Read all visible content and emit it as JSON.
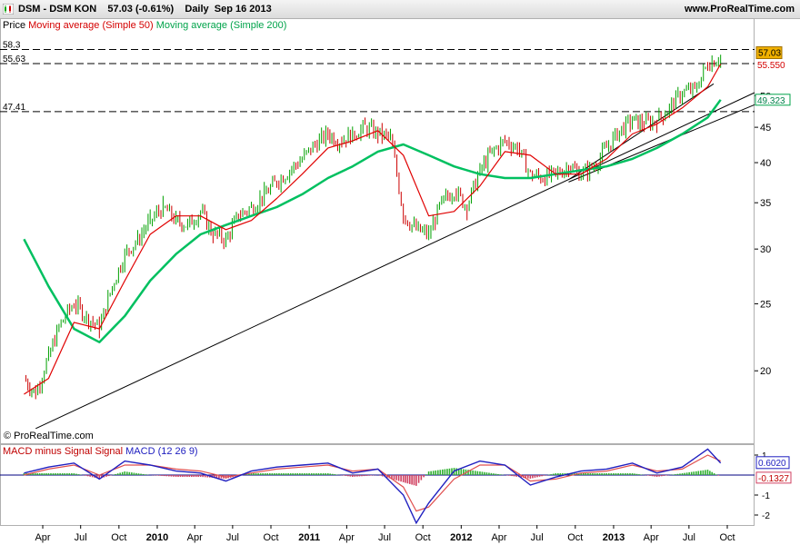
{
  "header": {
    "left_text": "DSM - DSM KON    57.03 (-0.61%)    Daily  Sep 16 2013",
    "right_text": "www.ProRealTime.com"
  },
  "indicators": {
    "price_label": "Price",
    "ma50_label": "Moving average (Simple 50)",
    "ma200_label": "Moving average (Simple 200)"
  },
  "watermark": "© ProRealTime.com",
  "macd_legend": {
    "part1": "MACD minus Signal",
    "part2": "Signal",
    "part3": "MACD (12 26 9)"
  },
  "colors": {
    "price_up": "#00a000",
    "price_down": "#cc0000",
    "ma50": "#e00000",
    "ma200": "#00c060",
    "macd": "#2020c0",
    "signal": "#e05050",
    "last_price_bg": "#f0b000",
    "ma200_badge_border": "#00a34a"
  },
  "chart_data": [
    {
      "type": "line",
      "title": "DSM - DSM KON Daily",
      "y_scale": "log",
      "ylim": [
        16,
        60
      ],
      "y_ticks": [
        20,
        25,
        30,
        35,
        40,
        45,
        50
      ],
      "x_range": [
        "2009-02",
        "2013-10"
      ],
      "x_tick_labels": [
        "Apr",
        "Jul",
        "Oct",
        "2010",
        "Apr",
        "Jul",
        "Oct",
        "2011",
        "Apr",
        "Jul",
        "Oct",
        "2012",
        "Apr",
        "Jul",
        "Oct",
        "2013",
        "Apr",
        "Jul",
        "Oct"
      ],
      "horizontal_levels": [
        {
          "label": "58.3",
          "value": 58.3
        },
        {
          "label": "55.63",
          "value": 55.63
        },
        {
          "label": "47.41",
          "value": 47.41
        }
      ],
      "last_price": "57.03",
      "ma50_value": "55.550",
      "ma200_value": "49.323",
      "series": [
        {
          "name": "Price",
          "x": [
            "2009-02",
            "2009-03",
            "2009-04",
            "2009-05",
            "2009-06",
            "2009-07",
            "2009-08",
            "2009-09",
            "2009-10",
            "2009-11",
            "2009-12",
            "2010-01",
            "2010-02",
            "2010-03",
            "2010-04",
            "2010-05",
            "2010-06",
            "2010-07",
            "2010-08",
            "2010-09",
            "2010-10",
            "2010-11",
            "2010-12",
            "2011-01",
            "2011-02",
            "2011-03",
            "2011-04",
            "2011-05",
            "2011-06",
            "2011-07",
            "2011-08",
            "2011-09",
            "2011-10",
            "2011-11",
            "2011-12",
            "2012-01",
            "2012-02",
            "2012-03",
            "2012-04",
            "2012-05",
            "2012-06",
            "2012-07",
            "2012-08",
            "2012-09",
            "2012-10",
            "2012-11",
            "2012-12",
            "2013-01",
            "2013-02",
            "2013-03",
            "2013-04",
            "2013-05",
            "2013-06",
            "2013-07",
            "2013-08",
            "2013-09"
          ],
          "values": [
            19.5,
            18.5,
            21.0,
            23.5,
            25.0,
            24.0,
            23.0,
            26.5,
            29.5,
            31.0,
            33.0,
            34.5,
            33.0,
            32.5,
            34.0,
            31.5,
            31.0,
            33.5,
            34.5,
            36.0,
            37.5,
            39.0,
            40.5,
            42.5,
            44.0,
            43.0,
            44.0,
            45.0,
            44.0,
            43.5,
            33.5,
            32.0,
            31.5,
            35.0,
            36.5,
            34.5,
            39.0,
            41.5,
            43.0,
            42.0,
            38.5,
            38.0,
            38.5,
            39.5,
            38.5,
            39.5,
            42.0,
            44.5,
            46.0,
            45.5,
            46.0,
            48.0,
            50.5,
            51.0,
            55.5,
            57.03
          ]
        },
        {
          "name": "Moving average (Simple 50)",
          "x": [
            "2009-02",
            "2009-04",
            "2009-06",
            "2009-08",
            "2009-10",
            "2009-12",
            "2010-02",
            "2010-04",
            "2010-06",
            "2010-08",
            "2010-10",
            "2010-12",
            "2011-02",
            "2011-04",
            "2011-06",
            "2011-08",
            "2011-10",
            "2011-12",
            "2012-02",
            "2012-04",
            "2012-06",
            "2012-08",
            "2012-10",
            "2012-12",
            "2013-02",
            "2013-04",
            "2013-06",
            "2013-08",
            "2013-09"
          ],
          "values": [
            18.5,
            19.5,
            23.5,
            23.0,
            27.0,
            31.5,
            33.5,
            33.5,
            32.0,
            33.0,
            35.5,
            38.5,
            42.0,
            43.0,
            44.5,
            41.0,
            33.5,
            34.0,
            37.0,
            41.5,
            41.0,
            38.5,
            38.5,
            40.5,
            44.0,
            45.5,
            48.0,
            51.5,
            55.55
          ]
        },
        {
          "name": "Moving average (Simple 200)",
          "x": [
            "2009-02",
            "2009-04",
            "2009-06",
            "2009-08",
            "2009-10",
            "2009-12",
            "2010-02",
            "2010-04",
            "2010-06",
            "2010-08",
            "2010-10",
            "2010-12",
            "2011-02",
            "2011-04",
            "2011-06",
            "2011-08",
            "2011-10",
            "2011-12",
            "2012-02",
            "2012-04",
            "2012-06",
            "2012-08",
            "2012-10",
            "2012-12",
            "2013-02",
            "2013-04",
            "2013-06",
            "2013-08",
            "2013-09"
          ],
          "values": [
            31.0,
            26.5,
            23.0,
            22.0,
            24.0,
            27.0,
            29.5,
            31.5,
            32.5,
            33.5,
            34.5,
            36.0,
            38.0,
            39.5,
            41.5,
            42.5,
            41.0,
            39.5,
            38.5,
            38.0,
            38.0,
            38.5,
            39.0,
            39.5,
            40.5,
            42.0,
            44.0,
            46.5,
            49.32
          ]
        }
      ]
    },
    {
      "type": "line",
      "title": "MACD (12 26 9)",
      "ylim": [
        -2.5,
        1.5
      ],
      "y_ticks": [
        1,
        -1,
        -2
      ],
      "macd_value": "0.6020",
      "signal_value": "-0.1327",
      "series": [
        {
          "name": "MACD",
          "x": [
            "2009-02",
            "2009-04",
            "2009-06",
            "2009-08",
            "2009-10",
            "2009-12",
            "2010-02",
            "2010-04",
            "2010-06",
            "2010-08",
            "2010-10",
            "2010-12",
            "2011-02",
            "2011-04",
            "2011-06",
            "2011-08",
            "2011-09",
            "2011-10",
            "2011-12",
            "2012-02",
            "2012-04",
            "2012-06",
            "2012-08",
            "2012-10",
            "2012-12",
            "2013-02",
            "2013-04",
            "2013-06",
            "2013-08",
            "2013-09"
          ],
          "values": [
            0.1,
            0.4,
            0.6,
            -0.2,
            0.7,
            0.5,
            0.2,
            0.1,
            -0.3,
            0.2,
            0.4,
            0.5,
            0.6,
            0.1,
            0.3,
            -1.0,
            -2.4,
            -1.4,
            0.2,
            0.7,
            0.5,
            -0.5,
            -0.1,
            0.2,
            0.3,
            0.6,
            0.1,
            0.4,
            1.3,
            0.6
          ]
        },
        {
          "name": "Signal",
          "x": [
            "2009-02",
            "2009-04",
            "2009-06",
            "2009-08",
            "2009-10",
            "2009-12",
            "2010-02",
            "2010-04",
            "2010-06",
            "2010-08",
            "2010-10",
            "2010-12",
            "2011-02",
            "2011-04",
            "2011-06",
            "2011-08",
            "2011-09",
            "2011-10",
            "2011-12",
            "2012-02",
            "2012-04",
            "2012-06",
            "2012-08",
            "2012-10",
            "2012-12",
            "2013-02",
            "2013-04",
            "2013-06",
            "2013-08",
            "2013-09"
          ],
          "values": [
            0.0,
            0.3,
            0.5,
            0.0,
            0.5,
            0.5,
            0.3,
            0.2,
            -0.1,
            0.1,
            0.3,
            0.4,
            0.5,
            0.2,
            0.3,
            -0.6,
            -1.8,
            -1.6,
            -0.2,
            0.5,
            0.5,
            -0.3,
            -0.2,
            0.1,
            0.2,
            0.5,
            0.2,
            0.3,
            1.0,
            0.7
          ]
        }
      ]
    }
  ]
}
